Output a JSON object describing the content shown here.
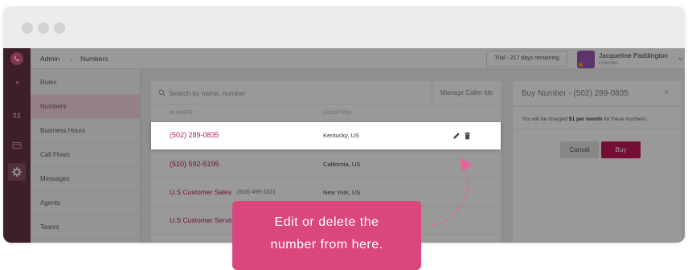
{
  "rail": {
    "icons": [
      "phone-icon",
      "bolt-icon",
      "people-icon",
      "card-icon",
      "gear-icon"
    ]
  },
  "header": {
    "breadcrumb": {
      "root": "Admin",
      "separator": "›",
      "current": "Numbers"
    },
    "trial": "Trial - 217 days remaining",
    "user": {
      "name": "Jacqueline Paddington",
      "status": "LOADING"
    }
  },
  "nav": {
    "items": [
      {
        "label": "Rules"
      },
      {
        "label": "Numbers",
        "active": true
      },
      {
        "label": "Business Hours"
      },
      {
        "label": "Call Flows"
      },
      {
        "label": "Messages"
      },
      {
        "label": "Agents"
      },
      {
        "label": "Teams"
      }
    ]
  },
  "numbers": {
    "search_placeholder": "Search by name, number",
    "manage_label": "Manage Caller Ids",
    "columns": {
      "number": "NUMBER",
      "location": "LOCATION"
    },
    "rows": [
      {
        "primary": "(502) 289-0835",
        "location": "Kentucky, US"
      },
      {
        "primary": "(510) 592-5195",
        "location": "California, US"
      },
      {
        "primary": "U.S Customer Sales",
        "secondary": "(516) 499-3321",
        "location": "New York, US"
      },
      {
        "primary": "U.S Customer Servic"
      }
    ]
  },
  "buy_panel": {
    "title": "Buy Number - (502) 289-0835",
    "close": "×",
    "charge_prefix": "You will be charged ",
    "charge_amount": "$1 per month",
    "charge_suffix": " for these numbers.",
    "cancel": "Cancel",
    "buy": "Buy"
  },
  "tooltip": {
    "lines": [
      "Edit or delete the",
      "number from here."
    ]
  },
  "colors": {
    "brand": "#c2185b",
    "tooltip": "#d9477e",
    "rail": "#663444"
  }
}
